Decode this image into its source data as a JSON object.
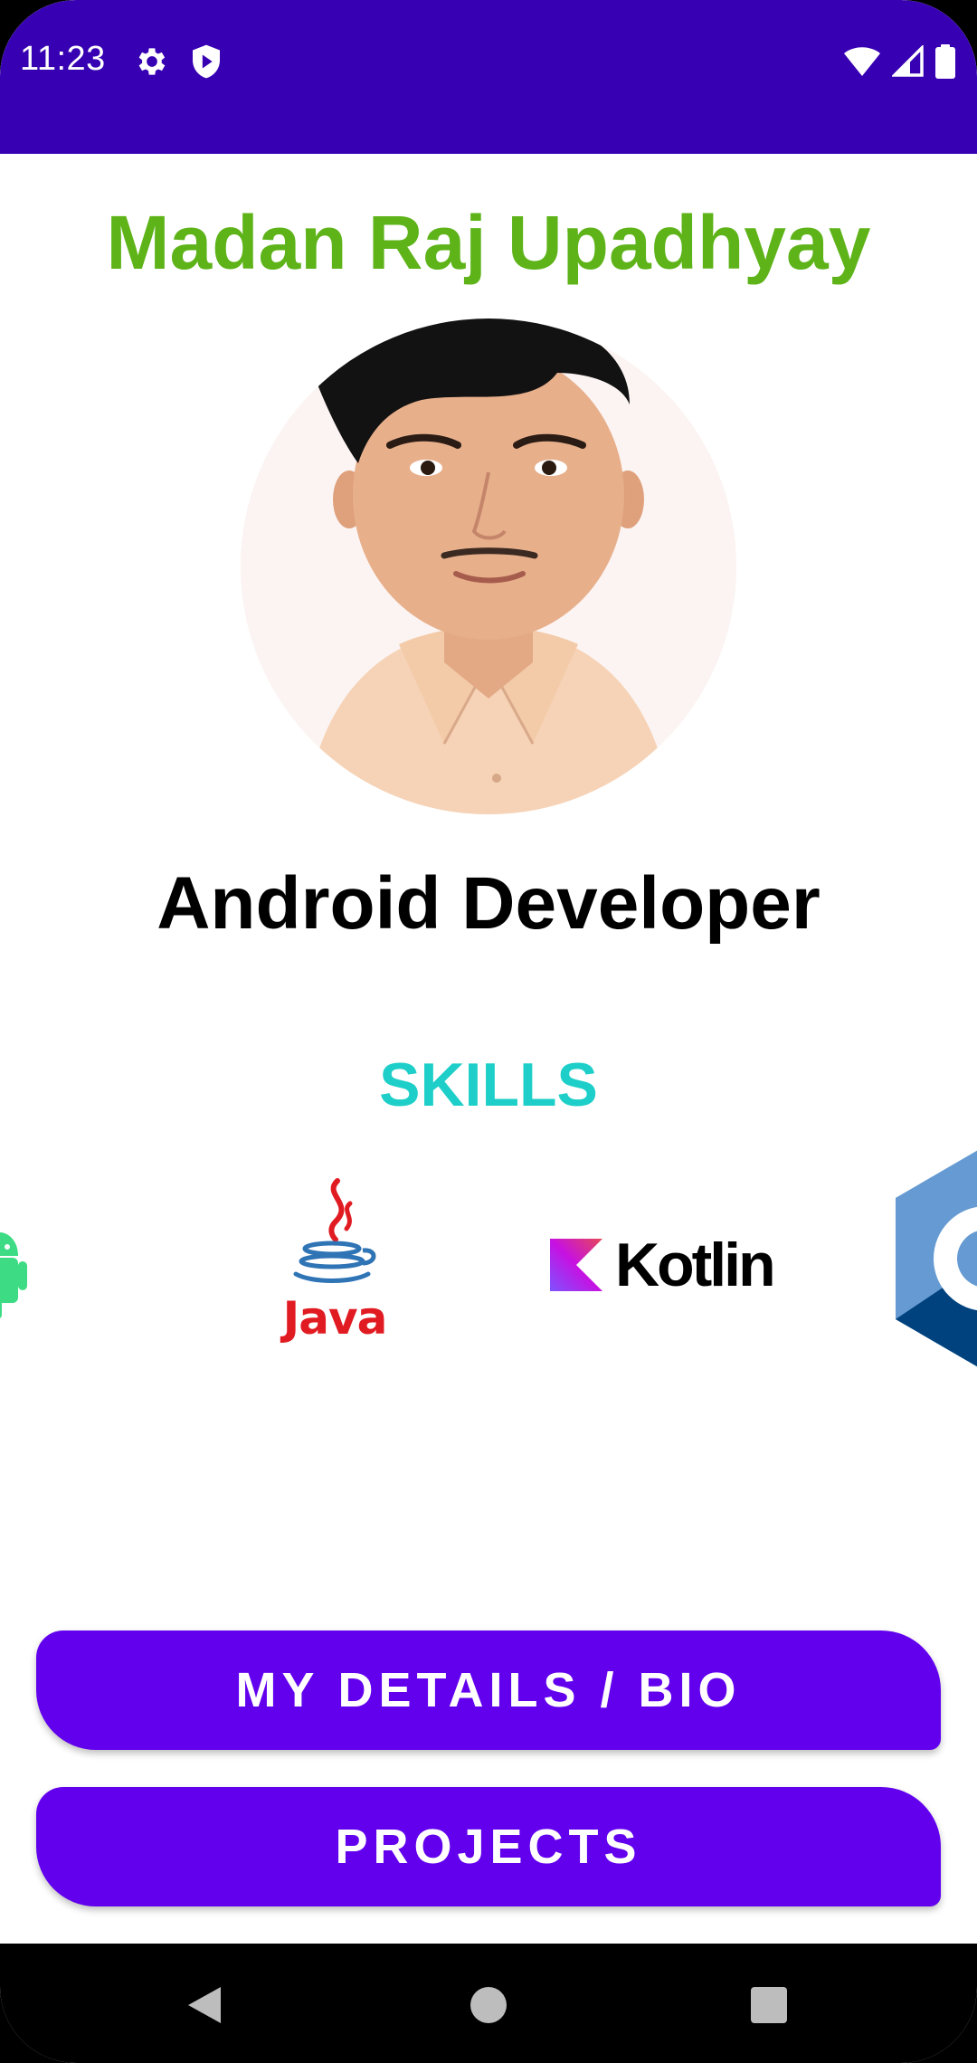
{
  "status_bar": {
    "time": "11:23",
    "icons": [
      "settings-icon",
      "shield-play-icon",
      "wifi-icon",
      "signal-icon",
      "battery-icon"
    ],
    "background": "#3700B3"
  },
  "profile": {
    "name": "Madan Raj Upadhyay",
    "name_color": "#5DB318",
    "role": "Android Developer",
    "avatar": "profile-photo"
  },
  "skills": {
    "heading": "SKILLS",
    "heading_color": "#1DCFC8",
    "items": [
      {
        "name": "android-logo"
      },
      {
        "name": "java-logo",
        "label": "Java"
      },
      {
        "name": "kotlin-logo",
        "label": "Kotlin"
      },
      {
        "name": "cpp-logo"
      }
    ]
  },
  "buttons": {
    "details_label": "MY DETAILS / BIO",
    "projects_label": "PROJECTS",
    "color": "#6200EE"
  },
  "nav_bar": {
    "icons": [
      "back-icon",
      "home-icon",
      "recents-icon"
    ]
  }
}
